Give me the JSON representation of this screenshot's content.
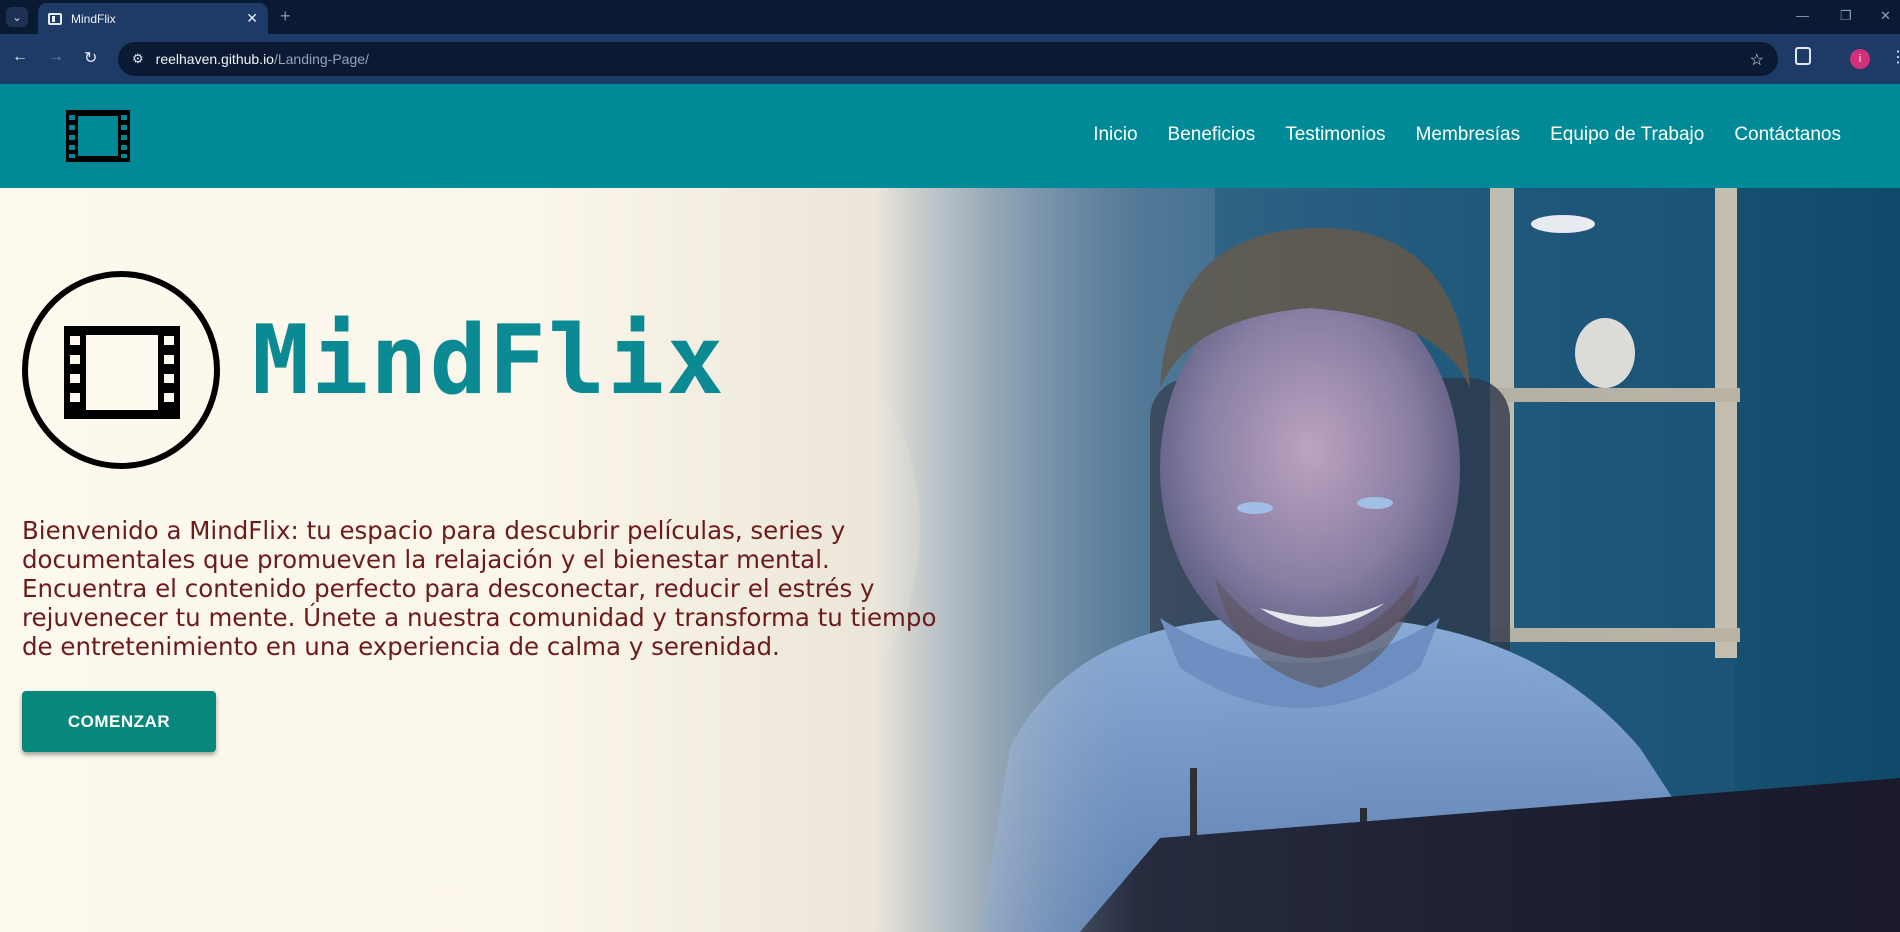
{
  "browser": {
    "tab_title": "MindFlix",
    "tab_close": "✕",
    "new_tab": "+",
    "url_host": "reelhaven.github.io",
    "url_path": "/Landing-Page/",
    "profile_initial": "i",
    "icons": [
      "tab-menu-icon",
      "favicon-film-icon",
      "back-icon",
      "forward-icon",
      "reload-icon",
      "site-info-icon",
      "star-icon",
      "extensions-icon",
      "more-icon",
      "minimize-icon",
      "restore-icon",
      "close-window-icon"
    ]
  },
  "header": {
    "logo_icon": "film-icon",
    "nav": [
      {
        "label": "Inicio"
      },
      {
        "label": "Beneficios"
      },
      {
        "label": "Testimonios"
      },
      {
        "label": "Membresías"
      },
      {
        "label": "Equipo de Trabajo"
      },
      {
        "label": "Contáctanos"
      }
    ],
    "color": "#008a98"
  },
  "hero": {
    "brand_name": "MindFlix",
    "brand_icon": "film-icon",
    "intro": "Bienvenido a MindFlix: tu espacio para descubrir películas, series y documentales que promueven la relajación y el bienestar mental. Encuentra el contenido perfecto para desconectar, reducir el estrés y rejuvenecer tu mente. Únete a nuestra comunidad y transforma tu tiempo de entretenimiento en una experiencia de calma y serenidad.",
    "cta_label": "COMENZAR",
    "colors": {
      "brand": "#0b8a94",
      "text": "#6c1b1b",
      "button": "#08887c",
      "background": "#fdf9ee"
    }
  }
}
